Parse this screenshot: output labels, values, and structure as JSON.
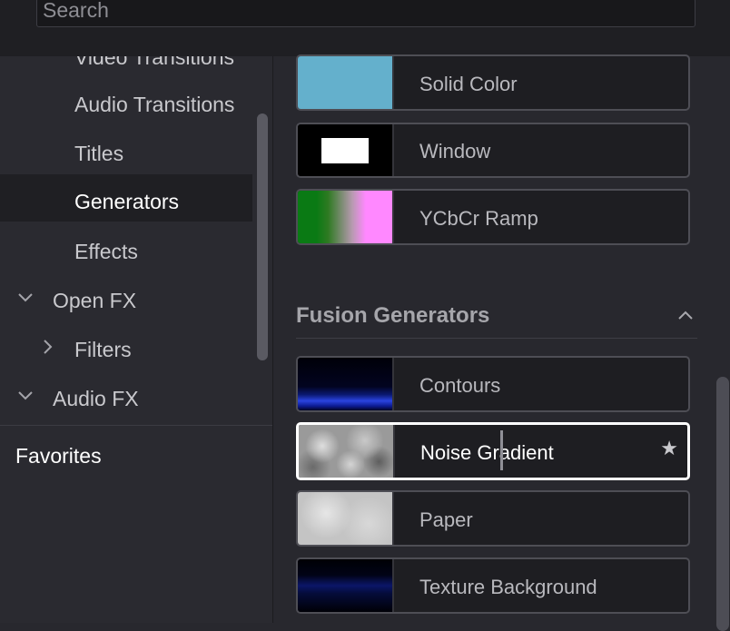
{
  "search": {
    "placeholder": "Search"
  },
  "sidebar": {
    "items": [
      {
        "label": "Video Transitions"
      },
      {
        "label": "Audio Transitions"
      },
      {
        "label": "Titles"
      },
      {
        "label": "Generators"
      },
      {
        "label": "Effects"
      },
      {
        "label": "Open FX"
      },
      {
        "label": "Filters"
      },
      {
        "label": "Audio FX"
      }
    ],
    "favorites_label": "Favorites"
  },
  "main": {
    "items": [
      {
        "label": "Solid Color",
        "thumb": "solid-color"
      },
      {
        "label": "Window",
        "thumb": "window"
      },
      {
        "label": "YCbCr Ramp",
        "thumb": "ycbcr-ramp"
      }
    ],
    "section": {
      "title": "Fusion Generators",
      "icon": "chevron-up-icon"
    },
    "fusion_items": [
      {
        "label": "Contours",
        "thumb": "contours"
      },
      {
        "label": "Noise Gradient",
        "thumb": "noise",
        "selected": true,
        "favorite_icon": "star-icon"
      },
      {
        "label": "Paper",
        "thumb": "paper"
      },
      {
        "label": "Texture Background",
        "thumb": "texture"
      }
    ]
  },
  "colors": {
    "solid_color_swatch": "#64b0cc",
    "selected_border": "#ffffff"
  }
}
